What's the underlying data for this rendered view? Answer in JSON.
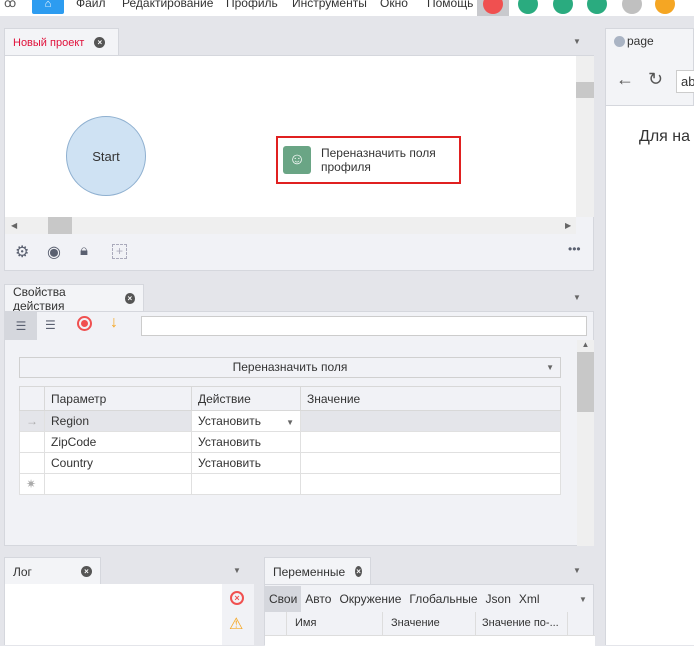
{
  "menu": {
    "items": [
      "Файл",
      "Редактирование",
      "Профиль",
      "Инструменты",
      "Окно",
      "Помощь"
    ]
  },
  "project": {
    "tab": "Новый проект",
    "start_node": "Start",
    "action_node": "Переназначить поля профиля"
  },
  "props": {
    "tab": "Свойства действия",
    "search_value": "",
    "action_select": "Переназначить поля",
    "columns": [
      "Параметр",
      "Действие",
      "Значение"
    ],
    "rows": [
      {
        "param": "Region",
        "action": "Установить",
        "value": ""
      },
      {
        "param": "ZipCode",
        "action": "Установить",
        "value": ""
      },
      {
        "param": "Country",
        "action": "Установить",
        "value": ""
      }
    ]
  },
  "log": {
    "tab": "Лог"
  },
  "vars": {
    "tab": "Переменные",
    "subtabs": [
      "Свои",
      "Авто",
      "Окружение",
      "Глобальные",
      "Json",
      "Xml"
    ],
    "columns": [
      "Имя",
      "Значение",
      "Значение по-..."
    ]
  },
  "browser": {
    "tab": "page",
    "address": "ab",
    "content": "Для на"
  },
  "colors": {
    "accent": "#e02020",
    "home": "#2d9cf0",
    "green": "#2aab7f",
    "orange": "#f5a623",
    "node": "#cfe2f3"
  }
}
